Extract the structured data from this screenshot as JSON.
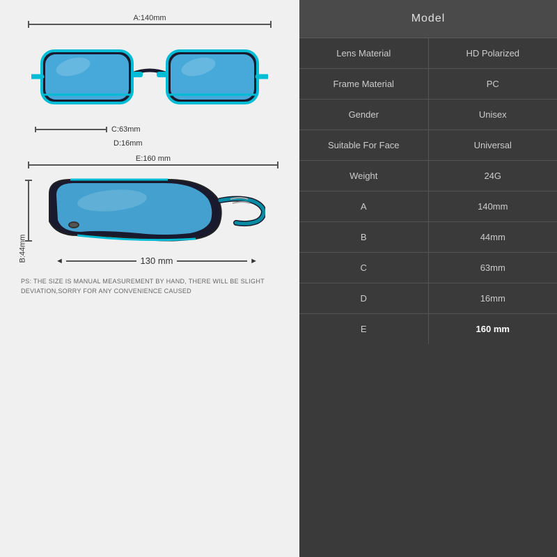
{
  "left": {
    "dim_a_label": "A:140mm",
    "dim_c_label": "C:63mm",
    "dim_d_label": "D:16mm",
    "dim_e_label": "E:160 mm",
    "dim_b_label": "B:44mm",
    "dim_130_label": "130 mm",
    "ps_note": "PS: THE SIZE IS MANUAL MEASUREMENT BY HAND, THERE WILL BE SLIGHT DEVIATION,SORRY FOR ANY CONVENIENCE CAUSED"
  },
  "right": {
    "header": "Model",
    "rows": [
      {
        "key": "Lens Material",
        "value": "HD Polarized",
        "bold": false
      },
      {
        "key": "Frame Material",
        "value": "PC",
        "bold": false
      },
      {
        "key": "Gender",
        "value": "Unisex",
        "bold": false
      },
      {
        "key": "Suitable For Face",
        "value": "Universal",
        "bold": false
      },
      {
        "key": "Weight",
        "value": "24G",
        "bold": false
      },
      {
        "key": "A",
        "value": "140mm",
        "bold": false
      },
      {
        "key": "B",
        "value": "44mm",
        "bold": false
      },
      {
        "key": "C",
        "value": "63mm",
        "bold": false
      },
      {
        "key": "D",
        "value": "16mm",
        "bold": false
      },
      {
        "key": "E",
        "value": "160 mm",
        "bold": true
      }
    ]
  }
}
